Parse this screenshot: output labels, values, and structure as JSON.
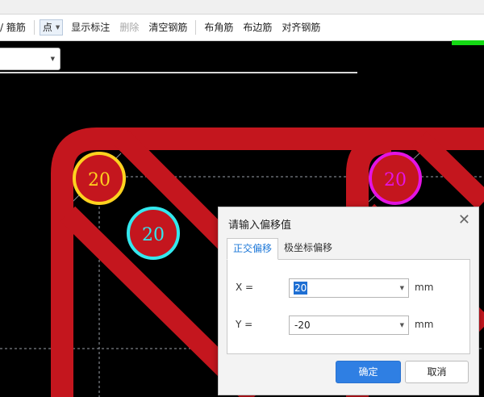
{
  "toolbar": {
    "partial_label": "箍筋",
    "partial_prefix": "/",
    "mode_value": "点",
    "show_label": "显示标注",
    "delete_label": "删除",
    "clear_label": "清空钢筋",
    "corner_label": "布角筋",
    "edge_label": "布边筋",
    "align_label": "对齐钢筋"
  },
  "canvas": {
    "markers": [
      {
        "text": "20",
        "color": "#ffd21f"
      },
      {
        "text": "20",
        "color": "#33e8ee"
      },
      {
        "text": "20",
        "color": "#e414e4"
      }
    ],
    "rebar_color": "#c4161e",
    "guide_color": "#9aa0a8"
  },
  "dialog": {
    "title": "请输入偏移值",
    "tabs": [
      {
        "label": "正交偏移",
        "active": true
      },
      {
        "label": "极坐标偏移",
        "active": false
      }
    ],
    "x_label": "X =",
    "x_value": "20",
    "y_label": "Y =",
    "y_value": "-20",
    "unit": "mm",
    "ok_label": "确定",
    "cancel_label": "取消"
  }
}
